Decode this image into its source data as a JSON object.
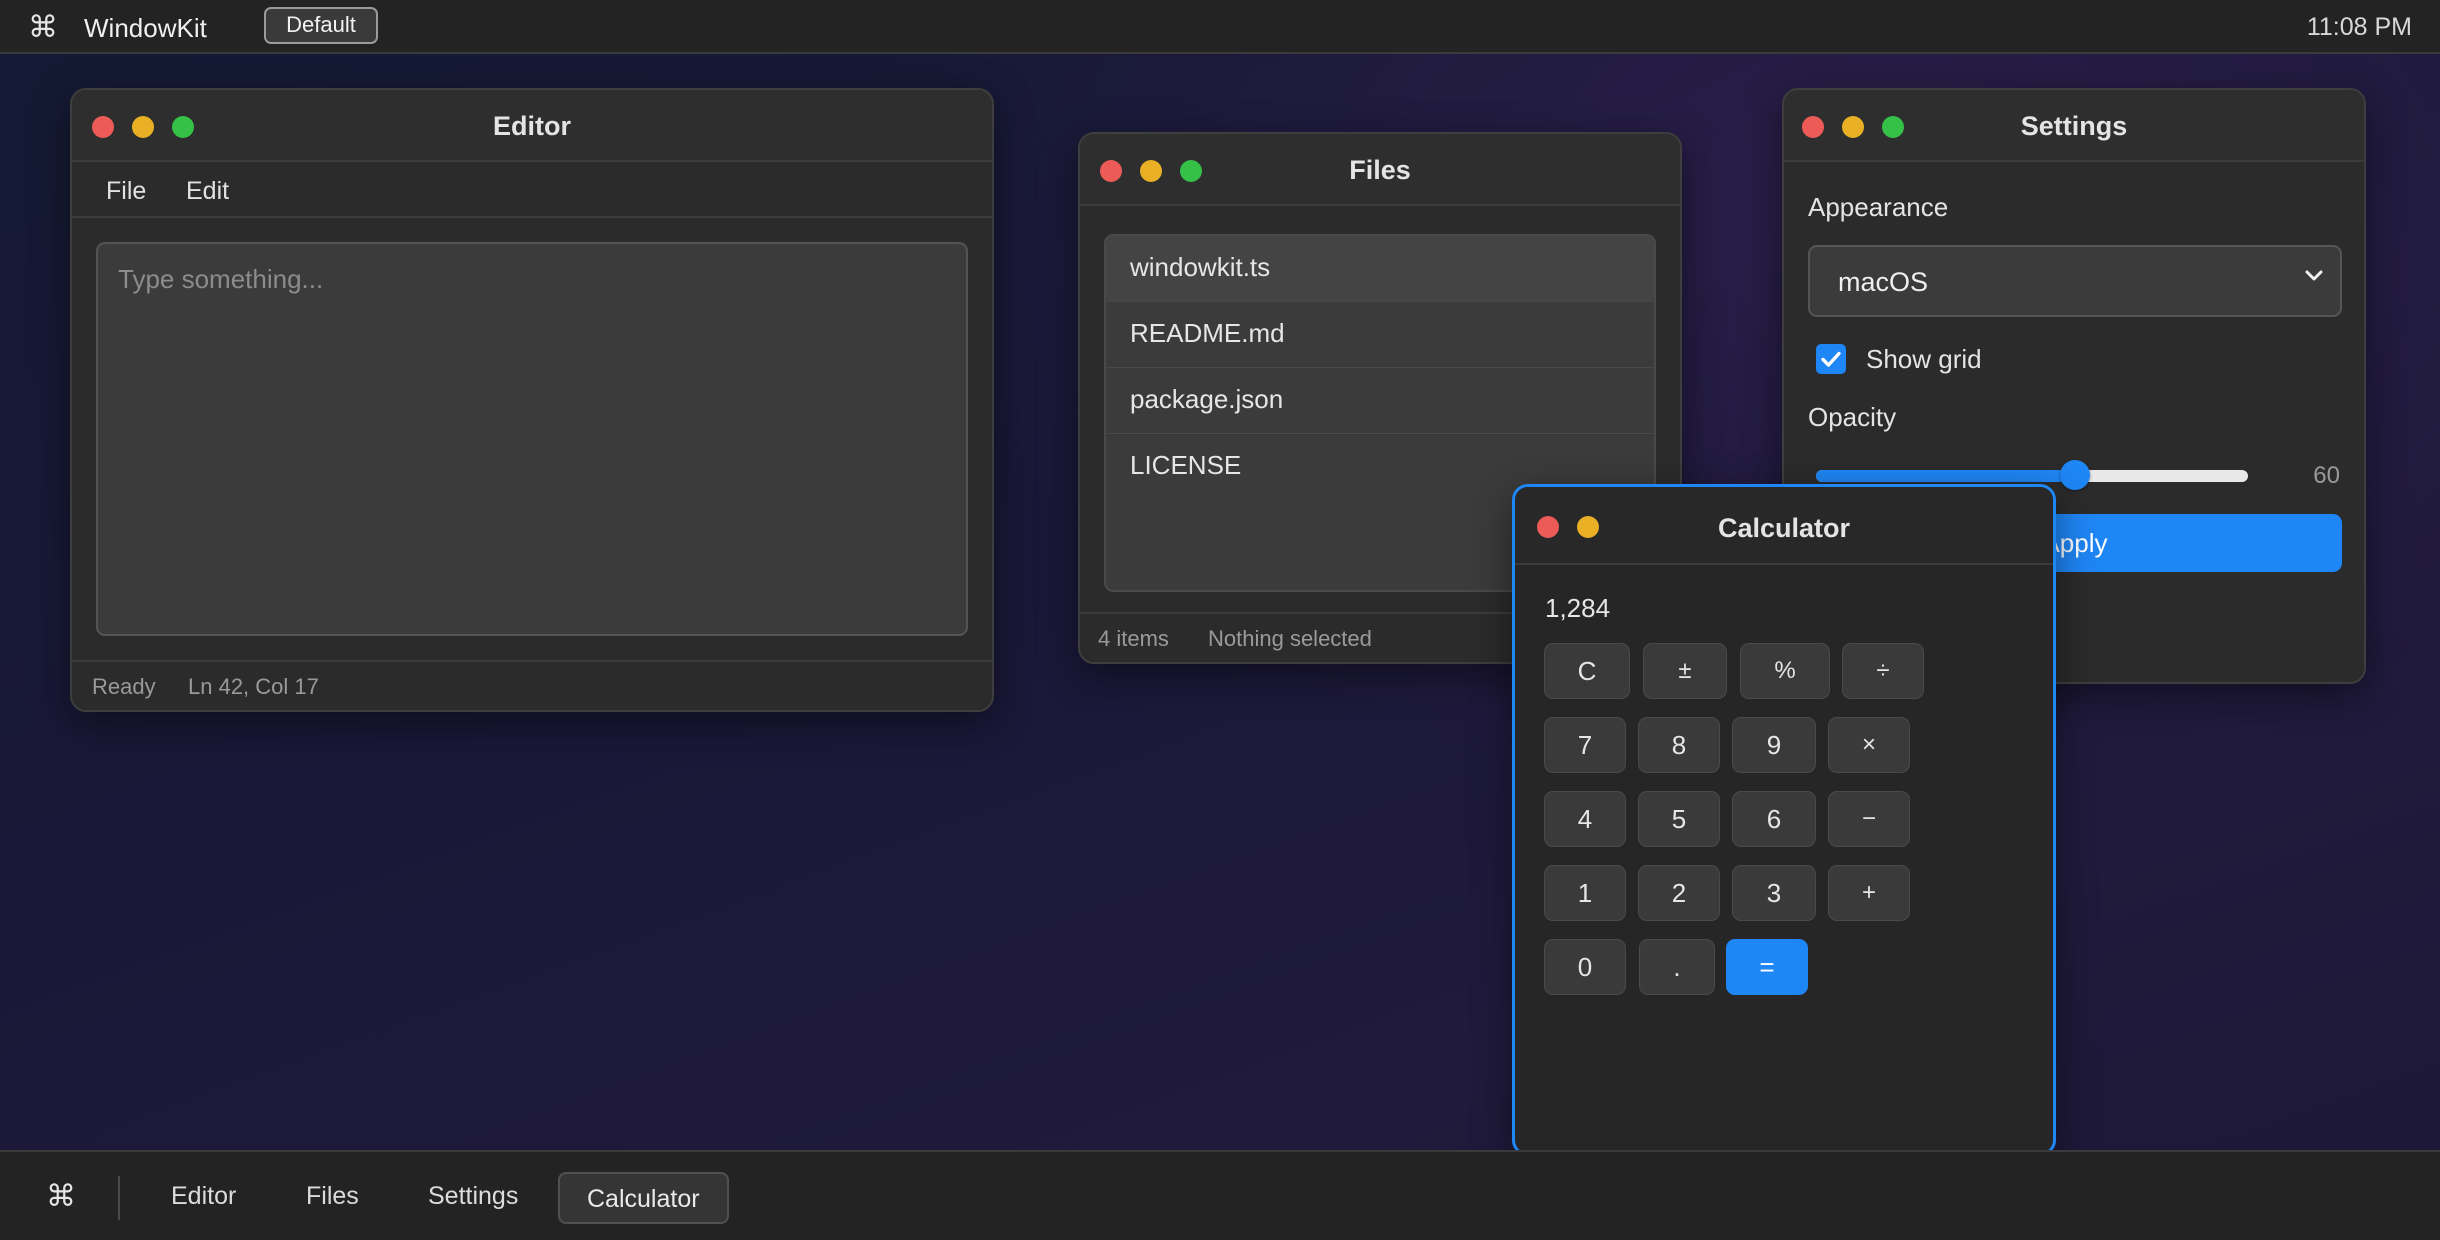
{
  "menubar": {
    "command_symbol": "⌘",
    "app_name": "WindowKit",
    "preset_label": "Default",
    "clock": "11:08 PM"
  },
  "editor": {
    "title": "Editor",
    "menu": [
      "File",
      "Edit"
    ],
    "placeholder": "Type something...",
    "status": "Ready",
    "cursor": "Ln 42, Col 17"
  },
  "files": {
    "title": "Files",
    "items": [
      "windowkit.ts",
      "README.md",
      "package.json",
      "LICENSE"
    ],
    "count_label": "4 items",
    "selection_label": "Nothing selected"
  },
  "settings": {
    "title": "Settings",
    "appearance_label": "Appearance",
    "appearance_value": "macOS",
    "show_grid_label": "Show grid",
    "show_grid_checked": true,
    "opacity_label": "Opacity",
    "opacity_value": "60",
    "opacity_fraction": 0.6,
    "apply_label": "Apply"
  },
  "calculator": {
    "title": "Calculator",
    "display": "1,284",
    "keys": [
      "C",
      "±",
      "%",
      "÷",
      "7",
      "8",
      "9",
      "×",
      "4",
      "5",
      "6",
      "−",
      "1",
      "2",
      "3",
      "+",
      "0",
      ".",
      "="
    ]
  },
  "dock": {
    "command_symbol": "⌘",
    "items": [
      "Editor",
      "Files",
      "Settings",
      "Calculator"
    ],
    "active": "Calculator"
  },
  "colors": {
    "accent": "#1f86f5",
    "close": "#ec5b57",
    "minimize": "#e9b026",
    "zoom": "#35c047"
  },
  "icons": {
    "close": "close-dot-icon",
    "minimize": "minimize-dot-icon",
    "zoom": "zoom-dot-icon",
    "select": "chevron-down-icon",
    "check": "checkmark-icon"
  }
}
